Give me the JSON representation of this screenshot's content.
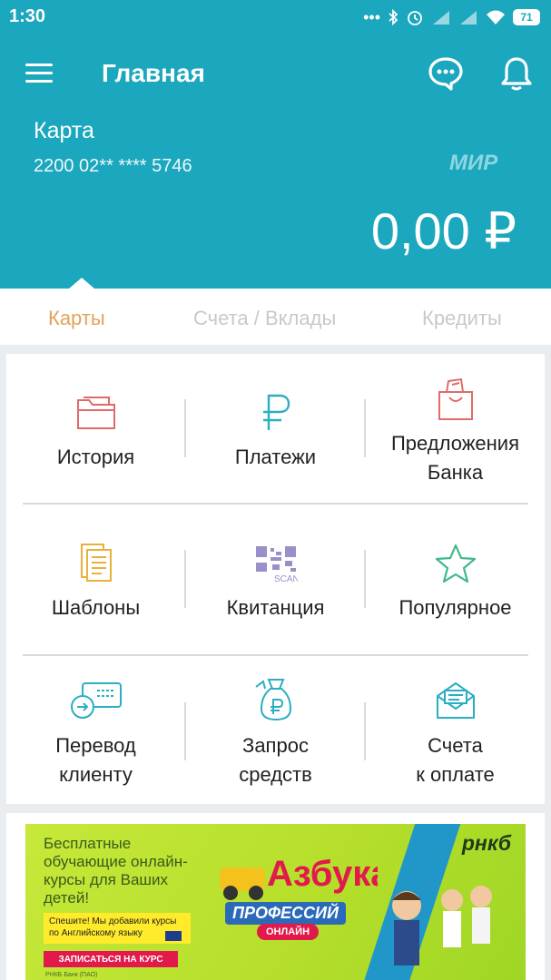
{
  "status_bar": {
    "time": "1:30",
    "battery": "71",
    "icons": [
      "more-icon",
      "bluetooth-icon",
      "alarm-icon",
      "signal-icon",
      "signal-icon",
      "wifi-icon",
      "battery-icon"
    ]
  },
  "header": {
    "title": "Главная",
    "card_name": "Карта",
    "card_number": "2200 02** **** 5746",
    "card_system": "МИР",
    "balance": "0,00 ₽",
    "background": "#1ba7bd"
  },
  "tabs": [
    {
      "label": "Карты",
      "active": true
    },
    {
      "label": "Счета / Вклады",
      "active": false
    },
    {
      "label": "Кредиты",
      "active": false
    }
  ],
  "colors": {
    "accent": "#1ba7bd",
    "active_tab": "#e3a35a",
    "inactive_tab": "#c4cacd",
    "icon_red": "#e06b6b",
    "icon_teal": "#2aaec2",
    "icon_yellow": "#e8b23a",
    "icon_green": "#3fb98a",
    "icon_purple": "#9b8fc9"
  },
  "actions": [
    {
      "line1": "История",
      "line2": "",
      "icon": "folder-icon"
    },
    {
      "line1": "Платежи",
      "line2": "",
      "icon": "ruble-icon"
    },
    {
      "line1": "Предложения",
      "line2": "Банка",
      "icon": "gift-bag-icon"
    },
    {
      "line1": "Шаблоны",
      "line2": "",
      "icon": "documents-icon"
    },
    {
      "line1": "Квитанция",
      "line2": "",
      "icon": "qr-scan-icon",
      "icon_text": "SCAN"
    },
    {
      "line1": "Популярное",
      "line2": "",
      "icon": "star-icon"
    },
    {
      "line1": "Перевод",
      "line2": "клиенту",
      "icon": "card-transfer-icon"
    },
    {
      "line1": "Запрос",
      "line2": "средств",
      "icon": "money-bag-icon"
    },
    {
      "line1": "Счета",
      "line2": "к оплате",
      "icon": "envelope-icon"
    }
  ],
  "banner": {
    "title": "Бесплатные обучающие онлайн-курсы для Ваших детей!",
    "brand": "рнкб",
    "note": "Спешите! Мы добавили курсы по Английскому языку",
    "cta": "ЗАПИСАТЬСЯ НА КУРС",
    "legal": "РНКБ Банк (ПАО)",
    "headline_top": "Азбука",
    "headline": "ПРОФЕССИЙ",
    "headline_sub": "ОНЛАЙН"
  }
}
